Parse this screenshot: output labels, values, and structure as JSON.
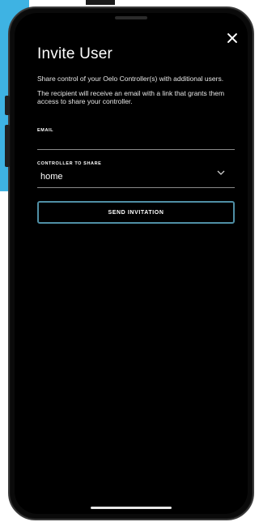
{
  "modal": {
    "title": "Invite User",
    "description_1": "Share control of your Oelo Controller(s) with additional users.",
    "description_2": "The recipient will receive an email with a link that grants them access to share your controller."
  },
  "email_field": {
    "label": "EMAIL",
    "value": "",
    "placeholder": ""
  },
  "controller_select": {
    "label": "CONTROLLER TO SHARE",
    "selected": "home"
  },
  "send_button": {
    "label": "SEND INVITATION"
  },
  "icons": {
    "close": "close-icon",
    "dropdown": "chevron-down-icon"
  },
  "colors": {
    "background": "#000000",
    "button_border": "#4f8fa5",
    "backdrop_accent": "#3eb3e3"
  }
}
